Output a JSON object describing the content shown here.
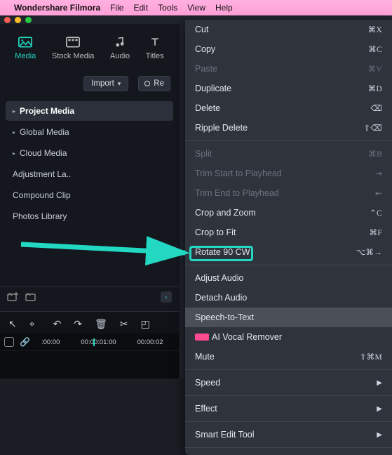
{
  "menubar": {
    "apple": "",
    "app_name": "Wondershare Filmora",
    "items": [
      "File",
      "Edit",
      "Tools",
      "View",
      "Help"
    ]
  },
  "tabs": [
    {
      "label": "Media",
      "active": true
    },
    {
      "label": "Stock Media",
      "active": false
    },
    {
      "label": "Audio",
      "active": false
    },
    {
      "label": "Titles",
      "active": false
    }
  ],
  "import_label": "Import",
  "record_label": "Re",
  "nav": [
    {
      "label": "Project Media",
      "selected": true
    },
    {
      "label": "Global Media",
      "selected": false
    },
    {
      "label": "Cloud Media",
      "selected": false
    },
    {
      "label": "Adjustment La..",
      "selected": false
    },
    {
      "label": "Compound Clip",
      "selected": false
    },
    {
      "label": "Photos Library",
      "selected": false
    }
  ],
  "timeline": {
    "ticks": [
      ":00:00",
      "00:00:01:00",
      "00:00:02"
    ]
  },
  "ctx": [
    {
      "type": "item",
      "label": "Cut",
      "sc": "⌘X"
    },
    {
      "type": "item",
      "label": "Copy",
      "sc": "⌘C"
    },
    {
      "type": "item",
      "label": "Paste",
      "sc": "⌘V",
      "dis": true
    },
    {
      "type": "item",
      "label": "Duplicate",
      "sc": "⌘D"
    },
    {
      "type": "item",
      "label": "Delete",
      "sc": "⌫"
    },
    {
      "type": "item",
      "label": "Ripple Delete",
      "sc": "⇧⌫"
    },
    {
      "type": "sep"
    },
    {
      "type": "item",
      "label": "Split",
      "sc": "⌘B",
      "dis": true
    },
    {
      "type": "item",
      "label": "Trim Start to Playhead",
      "sc": "⇥",
      "dis": true
    },
    {
      "type": "item",
      "label": "Trim End to Playhead",
      "sc": "⇤",
      "dis": true
    },
    {
      "type": "item",
      "label": "Crop and Zoom",
      "sc": "⌃C"
    },
    {
      "type": "item",
      "label": "Crop to Fit",
      "sc": "⌘F"
    },
    {
      "type": "item",
      "label": "Rotate 90 CW",
      "sc": "⌥⌘→"
    },
    {
      "type": "sep"
    },
    {
      "type": "item",
      "label": "Adjust Audio"
    },
    {
      "type": "item",
      "label": "Detach Audio"
    },
    {
      "type": "item",
      "label": "Speech-to-Text",
      "hi": true
    },
    {
      "type": "item",
      "label": "AI Vocal Remover",
      "new": true
    },
    {
      "type": "item",
      "label": "Mute",
      "sc": "⇧⌘M"
    },
    {
      "type": "sep"
    },
    {
      "type": "item",
      "label": "Speed",
      "sub": "▶"
    },
    {
      "type": "sep"
    },
    {
      "type": "item",
      "label": "Effect",
      "sub": "▶"
    },
    {
      "type": "sep"
    },
    {
      "type": "item",
      "label": "Smart Edit Tool",
      "sub": "▶"
    },
    {
      "type": "sep"
    }
  ]
}
